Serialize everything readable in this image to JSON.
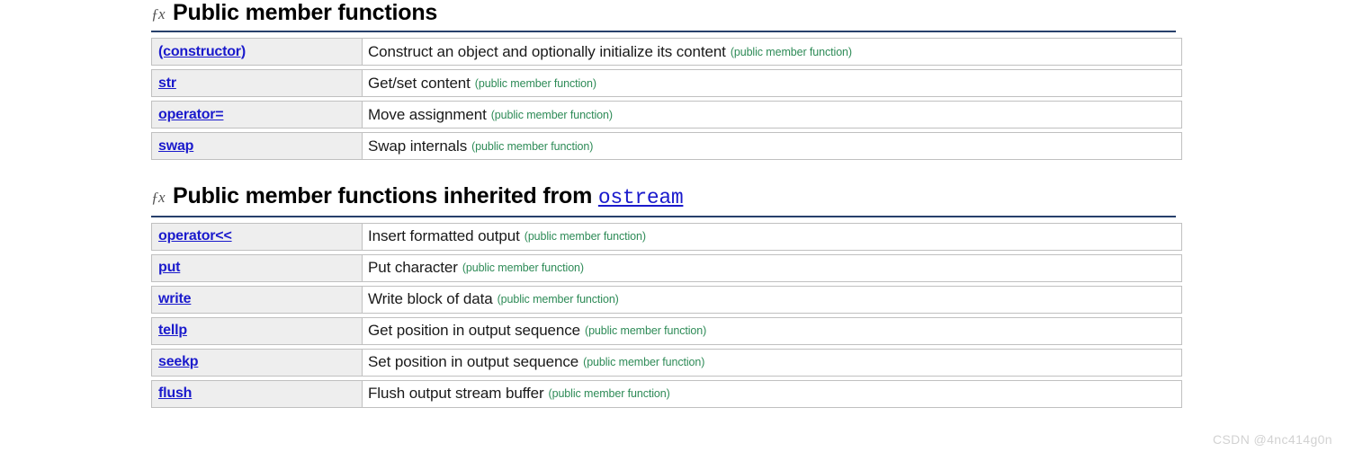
{
  "icons": {
    "fx": "ƒx"
  },
  "sections": [
    {
      "icon_name": "fx-icon",
      "title": "Public member functions",
      "inherited_from": null,
      "rows": [
        {
          "name": "(constructor)",
          "desc": "Construct an object and optionally initialize its content",
          "kind": "(public member function)"
        },
        {
          "name": "str",
          "desc": "Get/set content",
          "kind": "(public member function)"
        },
        {
          "name": "operator=",
          "desc": "Move assignment",
          "kind": "(public member function)"
        },
        {
          "name": "swap",
          "desc": "Swap internals",
          "kind": "(public member function)"
        }
      ]
    },
    {
      "icon_name": "fx-icon",
      "title": "Public member functions inherited from",
      "inherited_from": "ostream",
      "rows": [
        {
          "name": "operator<<",
          "desc": "Insert formatted output",
          "kind": "(public member function)"
        },
        {
          "name": "put",
          "desc": "Put character",
          "kind": "(public member function)"
        },
        {
          "name": "write",
          "desc": "Write block of data",
          "kind": "(public member function)"
        },
        {
          "name": "tellp",
          "desc": "Get position in output sequence",
          "kind": "(public member function)"
        },
        {
          "name": "seekp",
          "desc": "Set position in output sequence",
          "kind": "(public member function)"
        },
        {
          "name": "flush",
          "desc": "Flush output stream buffer",
          "kind": "(public member function)"
        }
      ]
    }
  ],
  "watermark": "CSDN @4nc414g0n",
  "colors": {
    "link": "#1a1acc",
    "kind_green": "#2e8b57",
    "rule_navy": "#27406b",
    "name_cell_bg": "#eeeeee",
    "border": "#c0c0c0"
  }
}
